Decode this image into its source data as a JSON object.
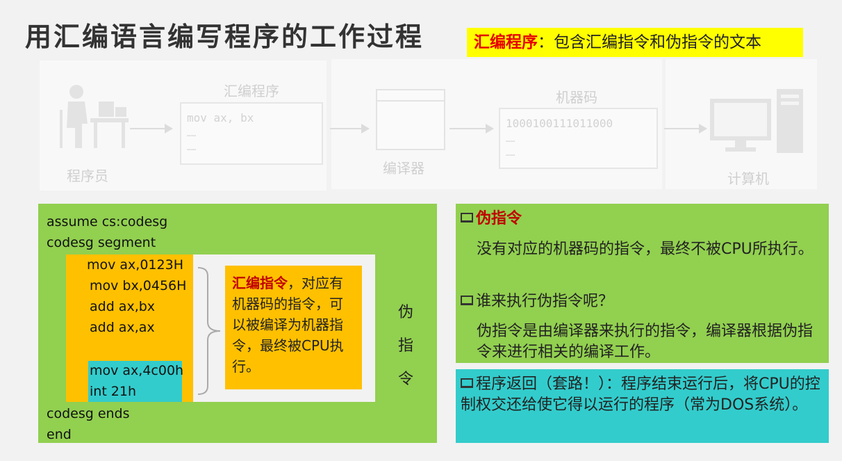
{
  "title": "用汇编语言编写程序的工作过程",
  "definition": {
    "term": "汇编程序",
    "text": "：包含汇编指令和伪指令的文本"
  },
  "diagram": {
    "programmer_label": "程序员",
    "asm_program_label": "汇编程序",
    "asm_code": [
      "mov ax, bx",
      "……",
      "……"
    ],
    "compiler_label": "编译器",
    "machine_code_label": "机器码",
    "machine_code": [
      "1000100111011000",
      "……",
      "……"
    ],
    "computer_label": "计算机"
  },
  "code": {
    "header": [
      "assume cs:codesg",
      "codesg segment"
    ],
    "asm_instructions": [
      "mov ax,0123H",
      "mov bx,0456H",
      "add ax,bx",
      "add ax,ax"
    ],
    "return_instructions": [
      "mov ax,4c00h",
      "int 21h"
    ],
    "footer": [
      "codesg ends",
      "end"
    ],
    "asm_note_term": "汇编指令",
    "asm_note_text": "，对应有机器码的指令，可以被编译为机器指令，最终被CPU执行。",
    "pseudo_label_chars": [
      "伪",
      "指",
      "令"
    ]
  },
  "right": {
    "pseudo_title": "伪指令",
    "pseudo_desc": "没有对应的机器码的指令，最终不被CPU所执行。",
    "question": "谁来执行伪指令呢？",
    "answer": "伪指令是由编译器来执行的指令，编译器根据伪指令来进行相关的编译工作。",
    "return_text": "程序返回（套路！）：程序结束运行后，将CPU的控制权交还给使它得以运行的程序（常为DOS系统）。"
  },
  "colors": {
    "green": "#92d050",
    "orange": "#ffc000",
    "cyan": "#33cccc",
    "yellow": "#ffff00",
    "red": "#c00000"
  }
}
